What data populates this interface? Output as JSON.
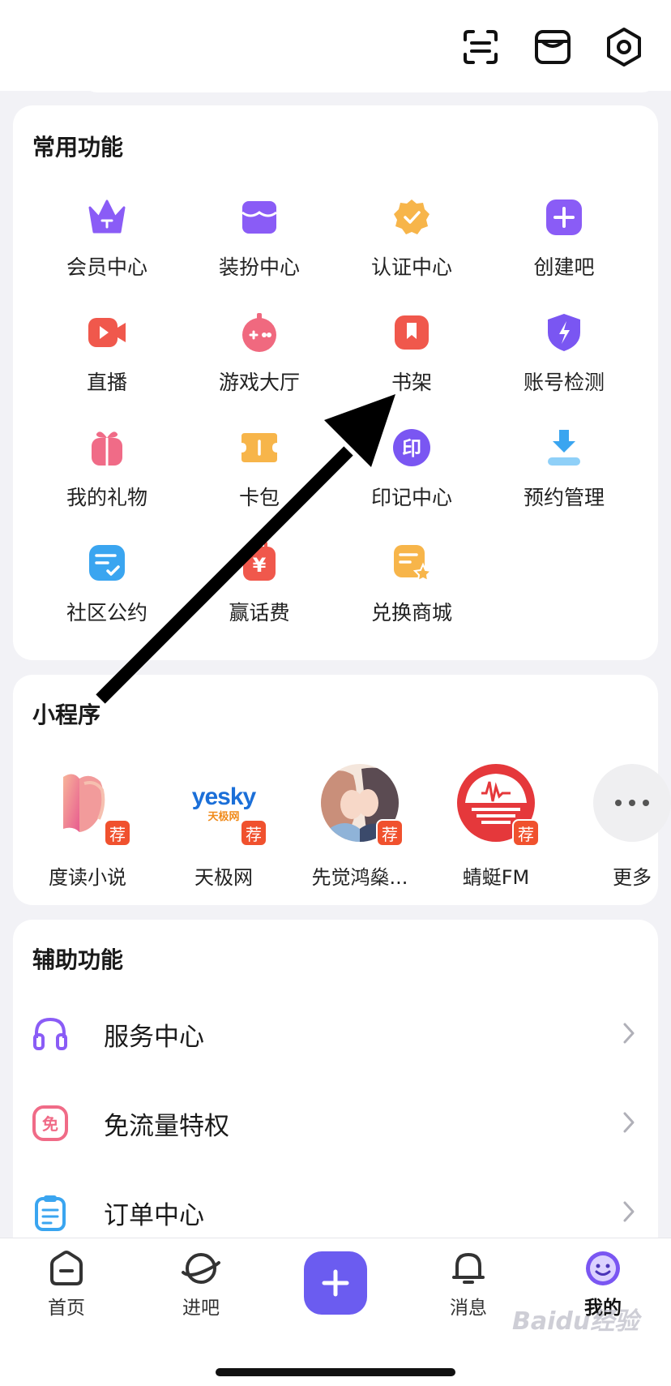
{
  "frequent": {
    "title": "常用功能",
    "items": [
      {
        "label": "会员中心",
        "icon": "crown-icon",
        "color": "#8a5cf6"
      },
      {
        "label": "装扮中心",
        "icon": "shop-icon",
        "color": "#8a5cf6"
      },
      {
        "label": "认证中心",
        "icon": "verified-badge-icon",
        "color": "#f7b54a"
      },
      {
        "label": "创建吧",
        "icon": "plus-square-icon",
        "color": "#8a5cf6"
      },
      {
        "label": "直播",
        "icon": "video-camera-icon",
        "color": "#f0584c"
      },
      {
        "label": "游戏大厅",
        "icon": "gamepad-icon",
        "color": "#f0697f"
      },
      {
        "label": "书架",
        "icon": "bookmark-icon",
        "color": "#f0584c"
      },
      {
        "label": "账号检测",
        "icon": "shield-bolt-icon",
        "color": "#7a56f2"
      },
      {
        "label": "我的礼物",
        "icon": "gift-icon",
        "color": "#f06b87"
      },
      {
        "label": "卡包",
        "icon": "ticket-icon",
        "color": "#f7b54a"
      },
      {
        "label": "印记中心",
        "icon": "seal-icon",
        "color": "#7a56f2",
        "glyph": "印"
      },
      {
        "label": "预约管理",
        "icon": "download-tray-icon",
        "color": "#3aa5f0"
      },
      {
        "label": "社区公约",
        "icon": "checklist-icon",
        "color": "#3aa5f0"
      },
      {
        "label": "赢话费",
        "icon": "yuan-icon",
        "color": "#f0584c",
        "glyph": "¥"
      },
      {
        "label": "兑换商城",
        "icon": "exchange-note-icon",
        "color": "#f7b54a"
      }
    ]
  },
  "mini_programs": {
    "title": "小程序",
    "rec_badge": "荐",
    "items": [
      {
        "label": "度读小说",
        "icon": "dudu-logo-icon"
      },
      {
        "label": "天极网",
        "icon": "yesky-logo-icon",
        "logo_text": "yesky",
        "logo_sub": "天极网"
      },
      {
        "label": "先觉鸿燊...",
        "icon": "couple-avatar-icon"
      },
      {
        "label": "蜻蜓FM",
        "icon": "qingting-fm-logo-icon"
      },
      {
        "label": "更多",
        "icon": "more-dots-icon"
      }
    ]
  },
  "assist": {
    "title": "辅助功能",
    "rows": [
      {
        "label": "服务中心",
        "icon": "headset-icon",
        "color": "#8a5cf6"
      },
      {
        "label": "免流量特权",
        "icon": "free-data-icon",
        "color": "#f06b87",
        "glyph": "免"
      },
      {
        "label": "订单中心",
        "icon": "clipboard-icon",
        "color": "#3aa5f0"
      }
    ]
  },
  "tabs": [
    {
      "label": "首页",
      "icon": "home-icon",
      "active": false
    },
    {
      "label": "进吧",
      "icon": "planet-icon",
      "active": false
    },
    {
      "label": "",
      "icon": "plus-icon",
      "active": false
    },
    {
      "label": "消息",
      "icon": "bell-icon",
      "active": false
    },
    {
      "label": "我的",
      "icon": "smile-avatar-icon",
      "active": true
    }
  ],
  "watermark": "Baidu经验",
  "colors": {
    "accent": "#6b5cf0",
    "background": "#f2f2f6"
  }
}
